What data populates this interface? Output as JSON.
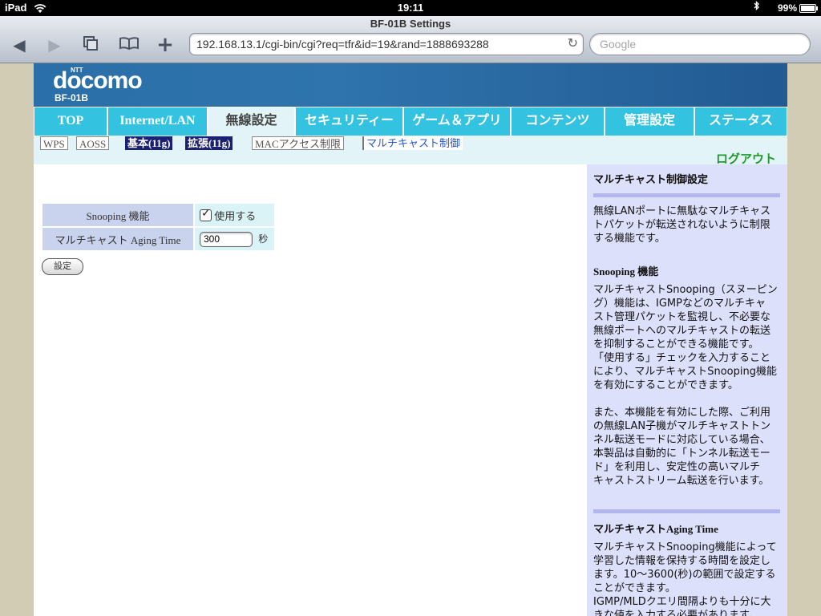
{
  "status_bar": {
    "device": "iPad",
    "time": "19:11",
    "battery": "99%",
    "battery_level": 0.99
  },
  "browser": {
    "title": "BF-01B Settings",
    "url": "192.168.13.1/cgi-bin/cgi?req=tfr&id=19&rand=1888693288",
    "search_placeholder": "Google"
  },
  "header": {
    "brand_small": "NTT",
    "brand": "docomo",
    "model": "BF-01B"
  },
  "tabs": [
    {
      "label": "TOP"
    },
    {
      "label": "Internet/LAN"
    },
    {
      "label": "無線設定"
    },
    {
      "label": "セキュリティー"
    },
    {
      "label": "ゲーム＆アプリ"
    },
    {
      "label": "コンテンツ"
    },
    {
      "label": "管理設定"
    },
    {
      "label": "ステータス"
    }
  ],
  "subtabs": [
    {
      "label": "WPS"
    },
    {
      "label": "AOSS"
    },
    {
      "label": "基本(11g)"
    },
    {
      "label": "拡張(11g)"
    },
    {
      "label": "MACアクセス制限"
    },
    {
      "label": "マルチキャスト制御"
    }
  ],
  "logout": "ログアウト",
  "form": {
    "snooping_label": "Snooping 機能",
    "snooping_checkbox_label": "使用する",
    "snooping_checked": true,
    "aging_label": "マルチキャスト Aging Time",
    "aging_value": "300",
    "aging_unit": "秒",
    "submit_label": "設定"
  },
  "help": {
    "title": "マルチキャスト制御設定",
    "intro": [
      "無線LANポートに無駄なマルチキャス",
      "トパケットが転送されないように制限",
      "する機能です。"
    ],
    "snooping_title": "Snooping 機能",
    "snooping_text": [
      "マルチキャストSnooping（スヌーピン",
      "グ）機能は、IGMPなどのマルチキャ",
      "スト管理パケットを監視し、不必要な",
      "無線ポートへのマルチキャストの転送",
      "を抑制することができる機能です。",
      "「使用する」チェックを入力すること",
      "により、マルチキャストSnooping機能",
      "を有効にすることができます。"
    ],
    "snooping_text2": [
      "また、本機能を有効にした際、ご利用",
      "の無線LAN子機がマルチキャストトン",
      "ネル転送モードに対応している場合、",
      "本製品は自動的に「トンネル転送モー",
      "ド」を利用し、安定性の高いマルチ",
      "キャストストリーム転送を行います。"
    ],
    "aging_title": "マルチキャストAging Time",
    "aging_text": [
      "マルチキャストSnooping機能によって",
      "学習した情報を保持する時間を設定し",
      "ます。10〜3600(秒)の範囲で設定する",
      "ことができます。",
      "IGMP/MLDクエリ間隔よりも十分に大",
      "きな値を入力する必要があります。"
    ]
  },
  "colors": {
    "tab": "#33c3e0",
    "tab_active": "#e2f4f7",
    "banner": "#2a6fa8",
    "help_bg": "#dde0fb",
    "logout": "#1f9a2a"
  }
}
